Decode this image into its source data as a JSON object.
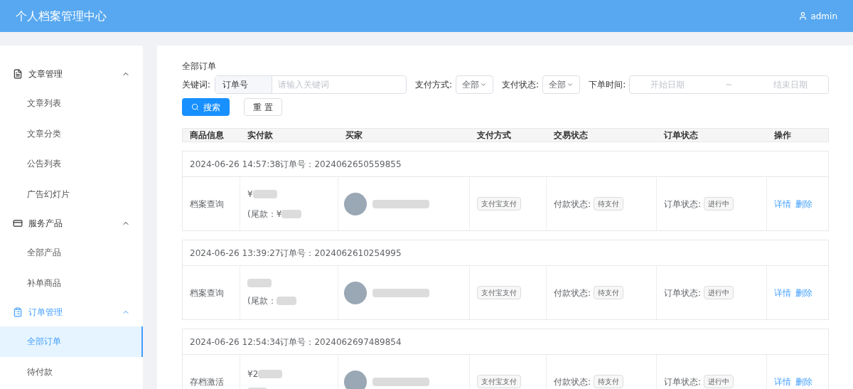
{
  "header": {
    "title": "个人档案管理中心",
    "user": "admin"
  },
  "sidebar": [
    {
      "label": "文章管理",
      "expanded": true,
      "children": [
        {
          "label": "文章列表",
          "selected": false
        },
        {
          "label": "文章分类",
          "selected": false
        },
        {
          "label": "公告列表",
          "selected": false
        },
        {
          "label": "广告幻灯片",
          "selected": false
        }
      ]
    },
    {
      "label": "服务产品",
      "expanded": true,
      "children": [
        {
          "label": "全部产品",
          "selected": false
        },
        {
          "label": "补单商品",
          "selected": false
        }
      ]
    },
    {
      "label": "订单管理",
      "expanded": true,
      "children": [
        {
          "label": "全部订单",
          "selected": true
        },
        {
          "label": "待付款",
          "selected": false
        }
      ]
    }
  ],
  "page_title": "全部订单",
  "filters": {
    "keyword_label": "关键词:",
    "keyword_type": "订单号",
    "keyword_placeholder": "请输入关键词",
    "pay_method_label": "支付方式:",
    "pay_method": "全部",
    "pay_status_label": "支付状态:",
    "pay_status": "全部",
    "time_label": "下单时间:",
    "start_placeholder": "开始日期",
    "separator": "~",
    "end_placeholder": "结束日期",
    "search_button": "搜索",
    "reset_button": "重 置"
  },
  "columns": [
    "商品信息",
    "实付款",
    "买家",
    "支付方式",
    "交易状态",
    "订单状态",
    "操作"
  ],
  "orders": [
    {
      "time": "2024-06-26 14:57:38订单号：2024062650559855",
      "product": "档案查询",
      "paid": "¥",
      "balance": "(尾款：¥",
      "pay_method": "支付宝支付",
      "pay_status_label": "付款状态:",
      "pay_status": "待支付",
      "order_status_label": "订单状态:",
      "order_status": "进行中",
      "actions": [
        "详情",
        "删除"
      ]
    },
    {
      "time": "2024-06-26 13:39:27订单号：2024062610254995",
      "product": "档案查询",
      "balance": "(尾款：",
      "pay_method": "支付宝支付",
      "pay_status_label": "付款状态:",
      "pay_status": "待支付",
      "order_status_label": "订单状态:",
      "order_status": "进行中",
      "actions": [
        "详情",
        "删除"
      ]
    },
    {
      "time": "2024-06-26 12:54:34订单号：2024062697489854",
      "product": "存档激活",
      "paid": "¥2",
      "pay_method": "支付宝支付",
      "pay_status_label": "付款状态:",
      "pay_status": "待支付",
      "order_status_label": "订单状态:",
      "order_status": "进行中",
      "actions": [
        "详情",
        "删除"
      ]
    }
  ]
}
